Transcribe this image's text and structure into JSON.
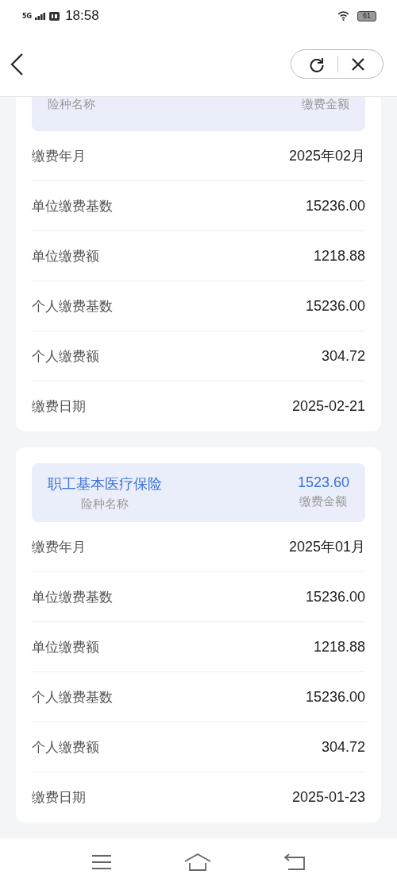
{
  "status_bar": {
    "network": "5G",
    "time": "18:58",
    "battery": "61"
  },
  "cards": [
    {
      "header": {
        "name_label": "险种名称",
        "amount_label": "缴费金额"
      },
      "rows": [
        {
          "label": "缴费年月",
          "value": "2025年02月"
        },
        {
          "label": "单位缴费基数",
          "value": "15236.00"
        },
        {
          "label": "单位缴费额",
          "value": "1218.88"
        },
        {
          "label": "个人缴费基数",
          "value": "15236.00"
        },
        {
          "label": "个人缴费额",
          "value": "304.72"
        },
        {
          "label": "缴费日期",
          "value": "2025-02-21"
        }
      ]
    },
    {
      "header": {
        "name": "职工基本医疗保险",
        "amount": "1523.60",
        "name_label": "险种名称",
        "amount_label": "缴费金额"
      },
      "rows": [
        {
          "label": "缴费年月",
          "value": "2025年01月"
        },
        {
          "label": "单位缴费基数",
          "value": "15236.00"
        },
        {
          "label": "单位缴费额",
          "value": "1218.88"
        },
        {
          "label": "个人缴费基数",
          "value": "15236.00"
        },
        {
          "label": "个人缴费额",
          "value": "304.72"
        },
        {
          "label": "缴费日期",
          "value": "2025-01-23"
        }
      ]
    }
  ]
}
